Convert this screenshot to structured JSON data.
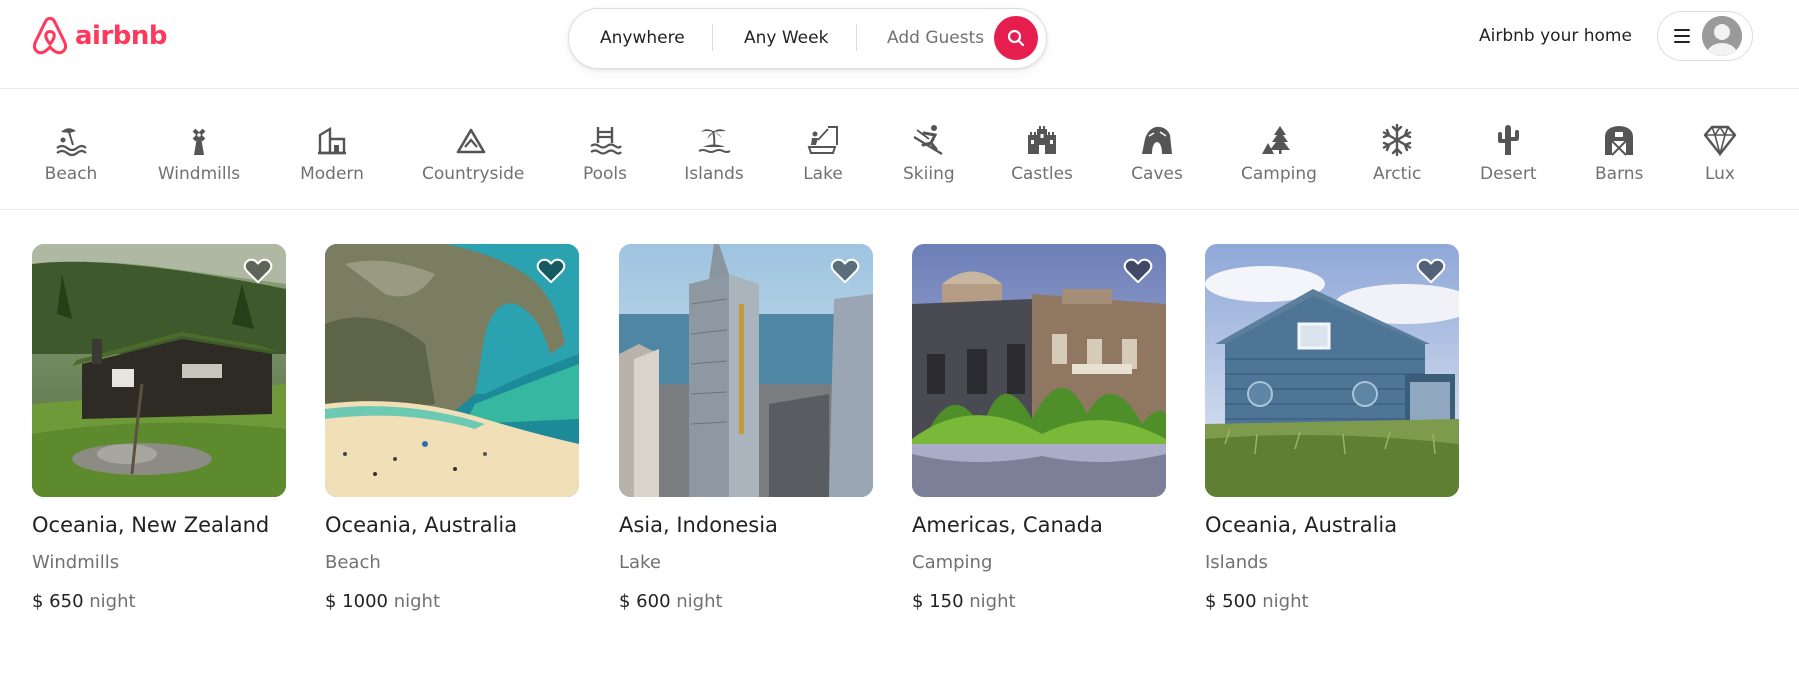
{
  "header": {
    "logo_text": "airbnb",
    "search": {
      "location": "Anywhere",
      "dates": "Any Week",
      "guests": "Add Guests"
    },
    "host_link": "Airbnb your home",
    "brand_color": "#ff385c",
    "search_button_color": "#e61e4d"
  },
  "categories": [
    {
      "label": "Beach",
      "icon": "beach-icon"
    },
    {
      "label": "Windmills",
      "icon": "windmill-icon"
    },
    {
      "label": "Modern",
      "icon": "modern-house-icon"
    },
    {
      "label": "Countryside",
      "icon": "mountain-icon"
    },
    {
      "label": "Pools",
      "icon": "pool-icon"
    },
    {
      "label": "Islands",
      "icon": "island-icon"
    },
    {
      "label": "Lake",
      "icon": "lake-icon"
    },
    {
      "label": "Skiing",
      "icon": "skiing-icon"
    },
    {
      "label": "Castles",
      "icon": "castle-icon"
    },
    {
      "label": "Caves",
      "icon": "cave-icon"
    },
    {
      "label": "Camping",
      "icon": "camping-icon"
    },
    {
      "label": "Arctic",
      "icon": "snowflake-icon"
    },
    {
      "label": "Desert",
      "icon": "cactus-icon"
    },
    {
      "label": "Barns",
      "icon": "barn-icon"
    },
    {
      "label": "Lux",
      "icon": "diamond-icon"
    }
  ],
  "listings": [
    {
      "location": "Oceania, New Zealand",
      "category": "Windmills",
      "price": "$ 650",
      "unit": "night"
    },
    {
      "location": "Oceania, Australia",
      "category": "Beach",
      "price": "$ 1000",
      "unit": "night"
    },
    {
      "location": "Asia, Indonesia",
      "category": "Lake",
      "price": "$ 600",
      "unit": "night"
    },
    {
      "location": "Americas, Canada",
      "category": "Camping",
      "price": "$ 150",
      "unit": "night"
    },
    {
      "location": "Oceania, Australia",
      "category": "Islands",
      "price": "$ 500",
      "unit": "night"
    }
  ]
}
